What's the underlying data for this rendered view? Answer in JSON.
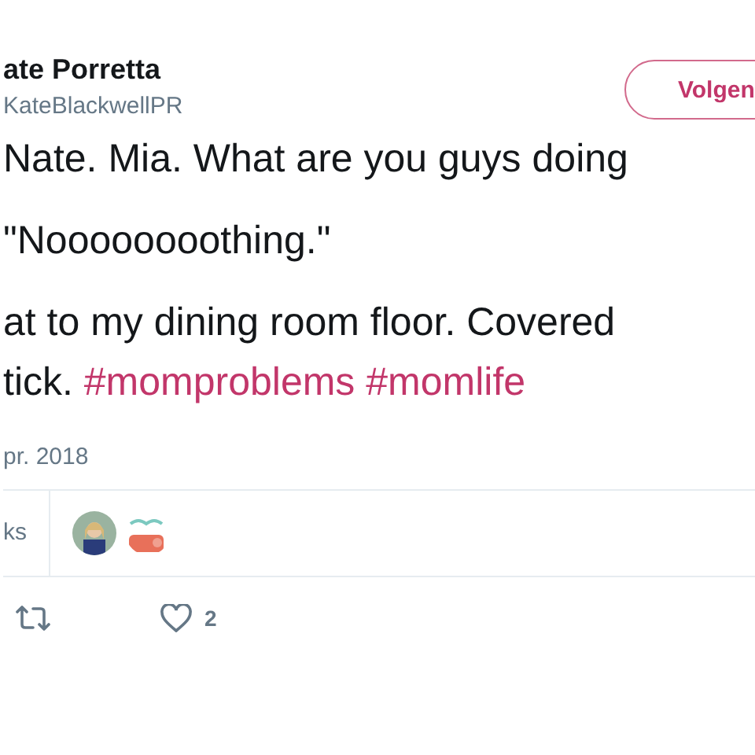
{
  "author": {
    "name": "ate Porretta",
    "handle": "KateBlackwellPR"
  },
  "follow_button": {
    "label": "Volgen"
  },
  "tweet_lines": [
    "Nate. Mia. What are you guys doing",
    "\"Noooooooothing.\"",
    "at to my dining room floor. Covered",
    "tick. **#momproblems #momlife**"
  ],
  "date": "pr. 2018",
  "stats": {
    "likes_label": "ks"
  },
  "actions": {
    "likes_count": "2"
  }
}
